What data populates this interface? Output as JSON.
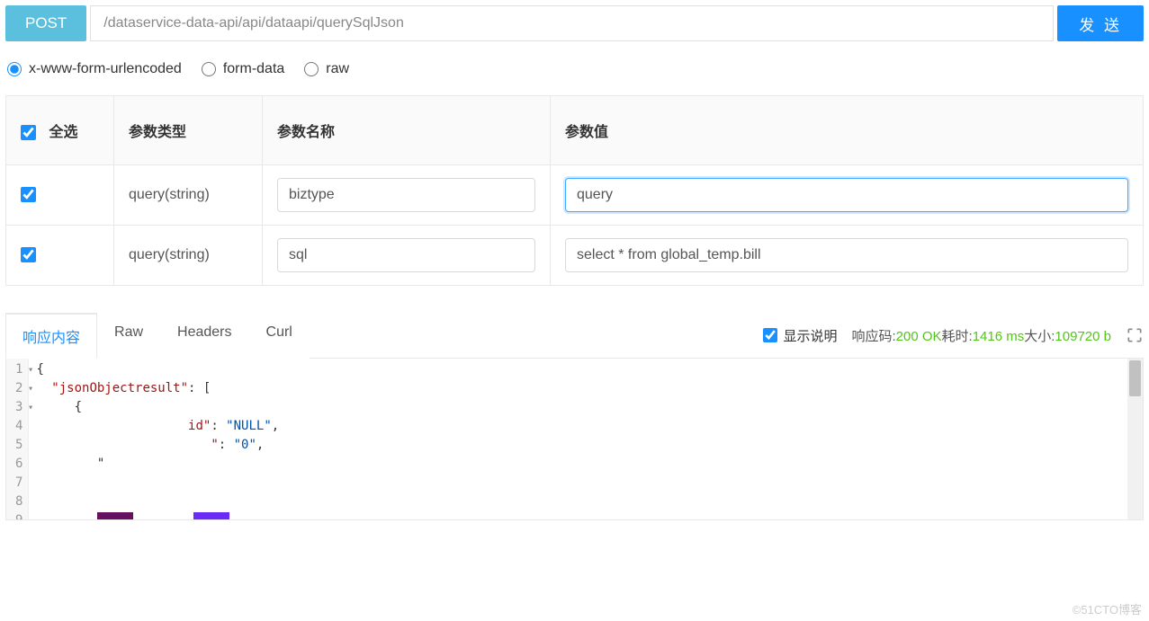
{
  "request": {
    "method": "POST",
    "url": "/dataservice-data-api/api/dataapi/querySqlJson",
    "send_label": "发 送"
  },
  "body_types": {
    "urlencoded": "x-www-form-urlencoded",
    "formdata": "form-data",
    "raw": "raw",
    "selected": "urlencoded"
  },
  "params_table": {
    "headers": {
      "select_all": "全选",
      "type": "参数类型",
      "name": "参数名称",
      "value": "参数值"
    },
    "rows": [
      {
        "checked": true,
        "type": "query(string)",
        "name": "biztype",
        "value": "query",
        "focused": true
      },
      {
        "checked": true,
        "type": "query(string)",
        "name": "sql",
        "value": "select * from global_temp.bill",
        "focused": false
      }
    ]
  },
  "response": {
    "tabs": {
      "content": "响应内容",
      "raw": "Raw",
      "headers": "Headers",
      "curl": "Curl"
    },
    "show_desc_label": "显示说明",
    "meta": {
      "code_label": "响应码:",
      "code_value": "200 OK",
      "time_label": "耗时:",
      "time_value": "1416 ms",
      "size_label": "大小:",
      "size_value": "109720 b"
    },
    "json": {
      "root_key": "jsonObjectresult",
      "line4_key": "id",
      "line4_val": "NULL",
      "line5_val": "0"
    }
  },
  "watermark": "©51CTO博客"
}
